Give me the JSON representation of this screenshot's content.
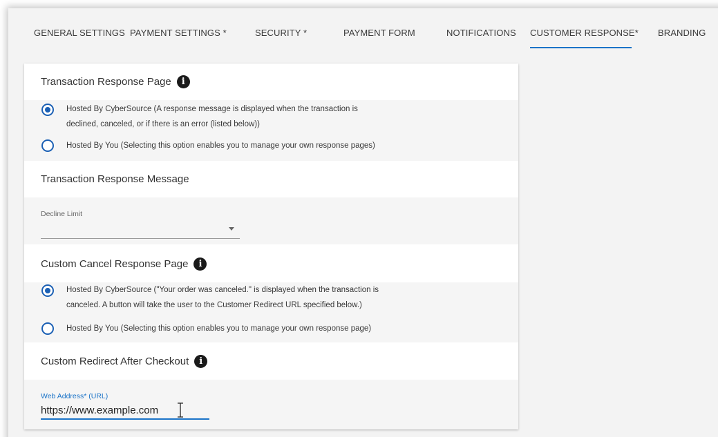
{
  "tabs": [
    {
      "label": "GENERAL SETTINGS"
    },
    {
      "label": "PAYMENT SETTINGS *"
    },
    {
      "label": "SECURITY *"
    },
    {
      "label": "PAYMENT FORM"
    },
    {
      "label": "NOTIFICATIONS"
    },
    {
      "label": "CUSTOMER RESPONSE*",
      "active": true
    },
    {
      "label": "BRANDING"
    }
  ],
  "response_page": {
    "title": "Transaction Response Page",
    "info_icon": "i",
    "options": [
      {
        "line1": "Hosted By CyberSource (A response message is displayed when the transaction is",
        "line2": "declined, canceled, or if there is an error (listed below))",
        "selected": true
      },
      {
        "line1": "Hosted By You (Selecting this option enables you to manage your own response pages)",
        "selected": false
      }
    ]
  },
  "response_message": {
    "title": "Transaction Response Message",
    "decline_limit": {
      "label": "Decline Limit",
      "value": ""
    }
  },
  "cancel_page": {
    "title": "Custom Cancel Response Page",
    "info_icon": "i",
    "options": [
      {
        "line1": "Hosted By CyberSource (\"Your order was canceled.\" is displayed when the transaction is",
        "line2": "canceled. A button will take the user to the Customer Redirect URL specified below.)",
        "selected": true
      },
      {
        "line1": "Hosted By You (Selecting this option enables you to manage your own response page)",
        "selected": false
      }
    ]
  },
  "redirect": {
    "title": "Custom Redirect After Checkout",
    "info_icon": "i",
    "web_address": {
      "label": "Web Address* (URL)",
      "value": "https://www.example.com"
    }
  },
  "colors": {
    "accent": "#1a73c8",
    "radio": "#1a5fb4",
    "panel": "#f5f5f5"
  }
}
